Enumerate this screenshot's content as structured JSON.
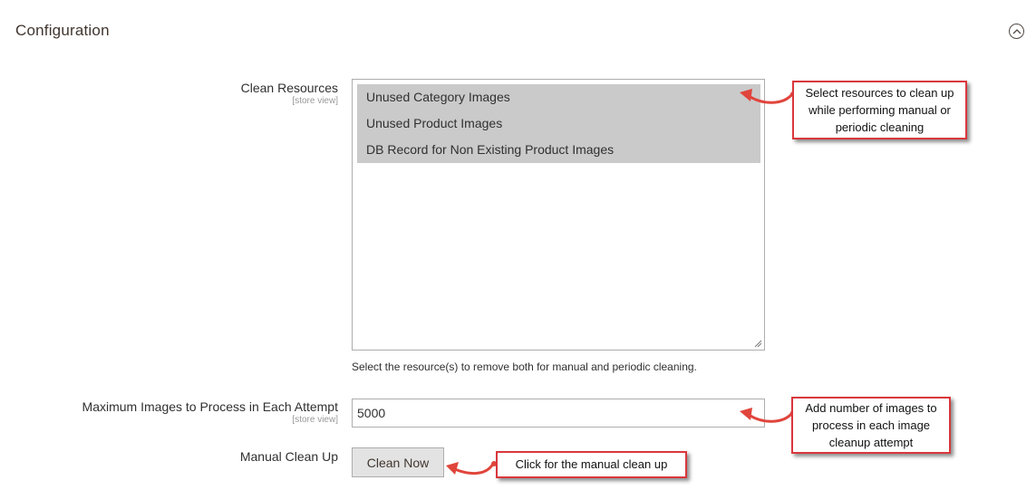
{
  "section": {
    "title": "Configuration",
    "collapse_icon": "chevron-up-circle-icon"
  },
  "fields": {
    "clean_resources": {
      "label": "Clean Resources",
      "scope": "[store view]",
      "options": [
        "Unused Category Images",
        "Unused Product Images",
        "DB Record for Non Existing Product Images"
      ],
      "note": "Select the resource(s) to remove both for manual and periodic cleaning."
    },
    "max_images": {
      "label": "Maximum Images to Process in Each Attempt",
      "scope": "[store view]",
      "value": "5000"
    },
    "manual_clean": {
      "label": "Manual Clean Up",
      "button_label": "Clean Now"
    }
  },
  "callouts": {
    "resources": "Select resources to clean up while performing manual or periodic cleaning",
    "max_images": "Add number of images to process in each image cleanup attempt",
    "clean_now": "Click for the manual clean up"
  },
  "colors": {
    "callout_border": "#d9373c",
    "selected_option_bg": "#cacaca"
  }
}
